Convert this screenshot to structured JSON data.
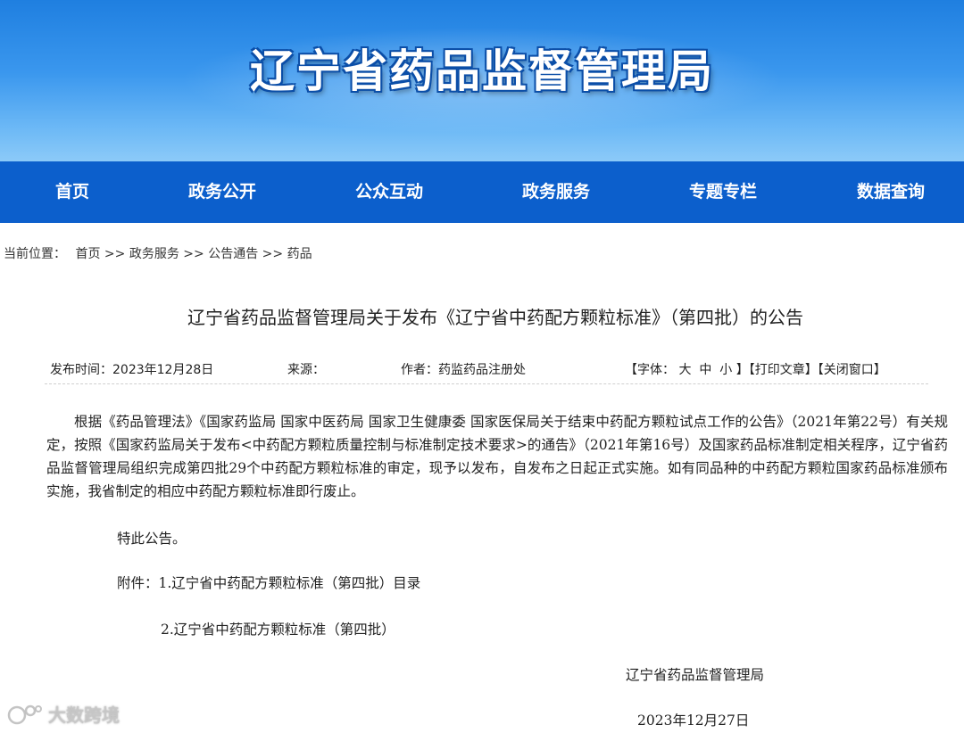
{
  "site": {
    "title": "辽宁省药品监督管理局"
  },
  "nav": {
    "items": [
      "首页",
      "政务公开",
      "公众互动",
      "政务服务",
      "专题专栏",
      "数据查询"
    ]
  },
  "breadcrumb": {
    "label": "当前位置：",
    "items": [
      "首页",
      "政务服务",
      "公告通告",
      "药品"
    ],
    "separator": ">>"
  },
  "article": {
    "title": "辽宁省药品监督管理局关于发布《辽宁省中药配方颗粒标准》（第四批）的公告",
    "meta": {
      "publish_label": "发布时间：",
      "publish_date": "2023年12月28日",
      "source_label": "来源：",
      "author_label": "作者：",
      "author": "药监药品注册处",
      "font_label": "【字体：",
      "font_large": "大",
      "font_medium": "中",
      "font_small": "小",
      "font_close": "】",
      "print": "【打印文章】",
      "close": "【关闭窗口】"
    },
    "paragraph": "根据《药品管理法》《国家药监局 国家中医药局 国家卫生健康委 国家医保局关于结束中药配方颗粒试点工作的公告》（2021年第22号）有关规定，按照《国家药监局关于发布<中药配方颗粒质量控制与标准制定技术要求>的通告》（2021年第16号）及国家药品标准制定相关程序，辽宁省药品监督管理局组织完成第四批29个中药配方颗粒标准的审定，现予以发布，自发布之日起正式实施。如有同品种的中药配方颗粒国家药品标准颁布实施，我省制定的相应中药配方颗粒标准即行废止。",
    "special": "特此公告。",
    "attachment_1": "附件：1.辽宁省中药配方颗粒标准（第四批）目录",
    "attachment_2": "2.辽宁省中药配方颗粒标准（第四批）",
    "signature_org": "辽宁省药品监督管理局",
    "signature_date": "2023年12月27日"
  },
  "watermark": {
    "text": "大数跨境"
  }
}
